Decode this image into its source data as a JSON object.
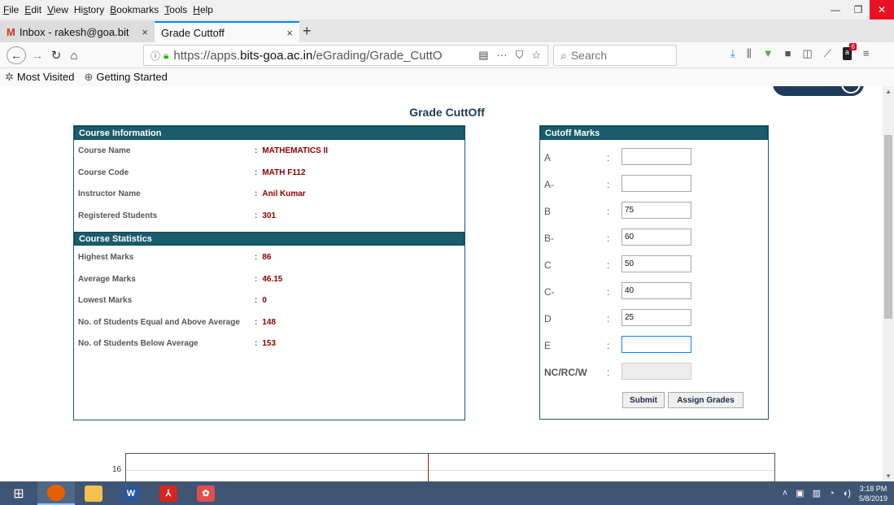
{
  "menu": [
    "File",
    "Edit",
    "View",
    "History",
    "Bookmarks",
    "Tools",
    "Help"
  ],
  "menu_access": [
    "F",
    "E",
    "V",
    "s",
    "B",
    "T",
    "H"
  ],
  "tabs": [
    {
      "title": "Inbox - rakesh@goa.bit",
      "close": "×"
    },
    {
      "title": "Grade Cuttoff",
      "close": "×"
    }
  ],
  "newtab": "+",
  "nav": {
    "url_prefix": "https://apps.",
    "url_domain": "bits-goa.ac.in",
    "url_path": "/eGrading/Grade_CuttO",
    "search_placeholder": "Search",
    "more": "···"
  },
  "bookmarks": [
    "Most Visited",
    "Getting Started"
  ],
  "page": {
    "title": "Grade CuttOff",
    "course_info": {
      "header": "Course Information",
      "rows": [
        {
          "label": "Course Name",
          "value": "MATHEMATICS II"
        },
        {
          "label": "Course Code",
          "value": "MATH F112"
        },
        {
          "label": "Instructor Name",
          "value": "Anil Kumar"
        },
        {
          "label": "Registered Students",
          "value": "301"
        }
      ]
    },
    "course_stats": {
      "header": "Course Statistics",
      "rows": [
        {
          "label": "Highest Marks",
          "value": "86"
        },
        {
          "label": "Average Marks",
          "value": "46.15"
        },
        {
          "label": "Lowest Marks",
          "value": "0"
        },
        {
          "label": "No. of Students Equal and Above Average",
          "value": "148"
        },
        {
          "label": "No. of Students Below Average",
          "value": "153"
        }
      ]
    },
    "colon": ":",
    "cutoff": {
      "header": "Cutoff Marks",
      "rows": [
        {
          "grade": "A",
          "value": ""
        },
        {
          "grade": "A-",
          "value": ""
        },
        {
          "grade": "B",
          "value": "75"
        },
        {
          "grade": "B-",
          "value": "60"
        },
        {
          "grade": "C",
          "value": "50"
        },
        {
          "grade": "C-",
          "value": "40"
        },
        {
          "grade": "D",
          "value": "25"
        },
        {
          "grade": "E",
          "value": ""
        },
        {
          "grade": "NC/RC/W",
          "value": ""
        }
      ],
      "submit_label": "Submit",
      "assign_label": "Assign Grades"
    },
    "chart_tick": "16"
  },
  "taskbar": {
    "clock_time": "3:18 PM",
    "clock_date": "5/8/2019"
  }
}
